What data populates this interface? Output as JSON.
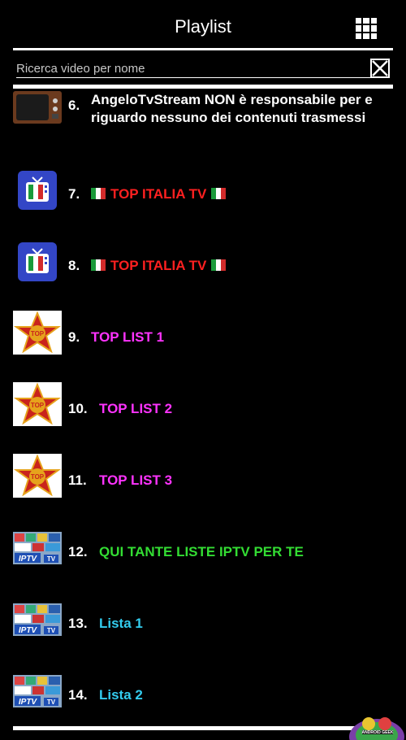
{
  "header": {
    "title": "Playlist",
    "menu_icon": "grid-icon"
  },
  "search": {
    "placeholder": "Ricerca video per nome",
    "clear_icon": "close-box-icon"
  },
  "items": [
    {
      "number": "6.",
      "label": "AngeloTvStream NON è responsabile per e riguardo nessuno dei contenuti trasmessi",
      "color": "#ffffff",
      "thumb": "tv-icon"
    },
    {
      "number": "7.",
      "label": "TOP ITALIA TV",
      "color": "#ff2020",
      "flags": true,
      "thumb": "italian-tv-icon"
    },
    {
      "number": "8.",
      "label": "TOP ITALIA TV",
      "color": "#ff2020",
      "flags": true,
      "thumb": "italian-tv-icon"
    },
    {
      "number": "9.",
      "label": "TOP LIST 1",
      "color": "#ff33ff",
      "thumb": "top-star-icon"
    },
    {
      "number": "10.",
      "label": "TOP LIST 2",
      "color": "#ff33ff",
      "thumb": "top-star-icon"
    },
    {
      "number": "11.",
      "label": "TOP LIST 3",
      "color": "#ff33ff",
      "thumb": "top-star-icon"
    },
    {
      "number": "12.",
      "label": "QUI TANTE LISTE IPTV PER TE",
      "color": "#33dd33",
      "thumb": "iptv-icon"
    },
    {
      "number": "13.",
      "label": "Lista 1",
      "color": "#33ccee",
      "thumb": "iptv-icon"
    },
    {
      "number": "14.",
      "label": "Lista 2",
      "color": "#33ccee",
      "thumb": "iptv-icon"
    }
  ],
  "thumb_text": {
    "top": "TOP",
    "iptv": "IPTV",
    "tv": "TV"
  },
  "watermark": {
    "text": "ANDROID GEEK",
    "icon": "android-watermark-icon"
  }
}
